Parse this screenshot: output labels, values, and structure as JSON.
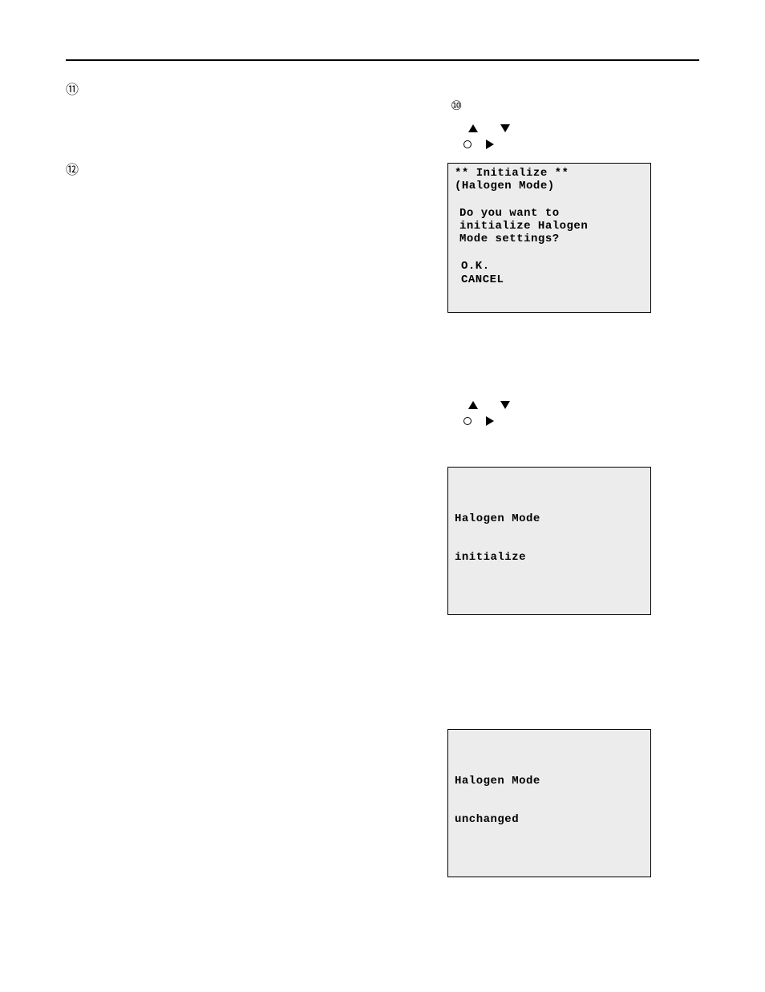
{
  "markers": {
    "c11": "⑪",
    "c12": "⑫",
    "c10": "⑩"
  },
  "box1": {
    "line1": "** Initialize **",
    "line2": "(Halogen Mode)",
    "q_line1": "Do you want to",
    "q_line2": "initialize Halogen",
    "q_line3": "Mode settings?",
    "opt_ok": "O.K.",
    "opt_cancel": "CANCEL"
  },
  "box2": {
    "line1": "Halogen Mode",
    "line2": "initialize"
  },
  "box3": {
    "line1": "Halogen Mode",
    "line2": "unchanged"
  }
}
